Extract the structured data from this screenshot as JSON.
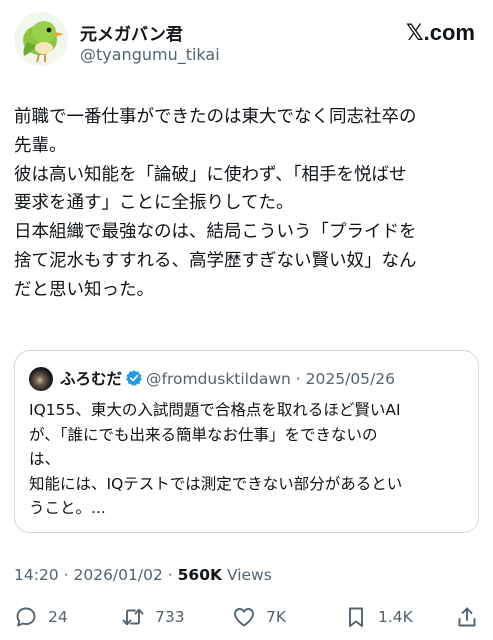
{
  "author": {
    "display_name": "元メガバン君",
    "handle": "@tyangumu_tikai"
  },
  "brand": {
    "label": "𝕏.com"
  },
  "tweet": {
    "lines": [
      "前職で一番仕事ができたのは東大でなく同志社卒の",
      "先輩。",
      "彼は高い知能を「論破」に使わず、「相手を悦ばせ",
      "要求を通す」ことに全振りしてた。",
      "日本組織で最強なのは、結局こういう「プライドを",
      "捨て泥水もすすれる、高学歴すぎない賢い奴」なん",
      "だと思い知った。"
    ]
  },
  "quote": {
    "author_name": "ふろむだ",
    "handle": "@fromdusktildawn",
    "separator": "·",
    "date": "2025/05/26",
    "lines": [
      "IQ155、東大の入試問題で合格点を取れるほど賢いAI",
      "が、「誰にでも出来る簡単なお仕事」をできないの",
      "は、",
      "知能には、IQテストでは測定できない部分があるとい",
      "うこと。..."
    ]
  },
  "meta": {
    "time": "14:20",
    "separator": "·",
    "date": "2026/01/02",
    "views_count": "560K",
    "views_label": "Views"
  },
  "actions": {
    "reply_count": "24",
    "retweet_count": "733",
    "like_count": "7K",
    "bookmark_count": "1.4K"
  },
  "icons": {
    "avatar": "green-bird-icon",
    "verified": "verified-badge-icon",
    "reply": "reply-icon",
    "retweet": "retweet-icon",
    "like": "heart-icon",
    "bookmark": "bookmark-icon",
    "share": "share-icon"
  },
  "colors": {
    "text_primary": "#0f1419",
    "text_secondary": "#536471",
    "border": "#cfd9de",
    "verified_blue": "#1d9bf0",
    "bird_green": "#8cc63f"
  }
}
